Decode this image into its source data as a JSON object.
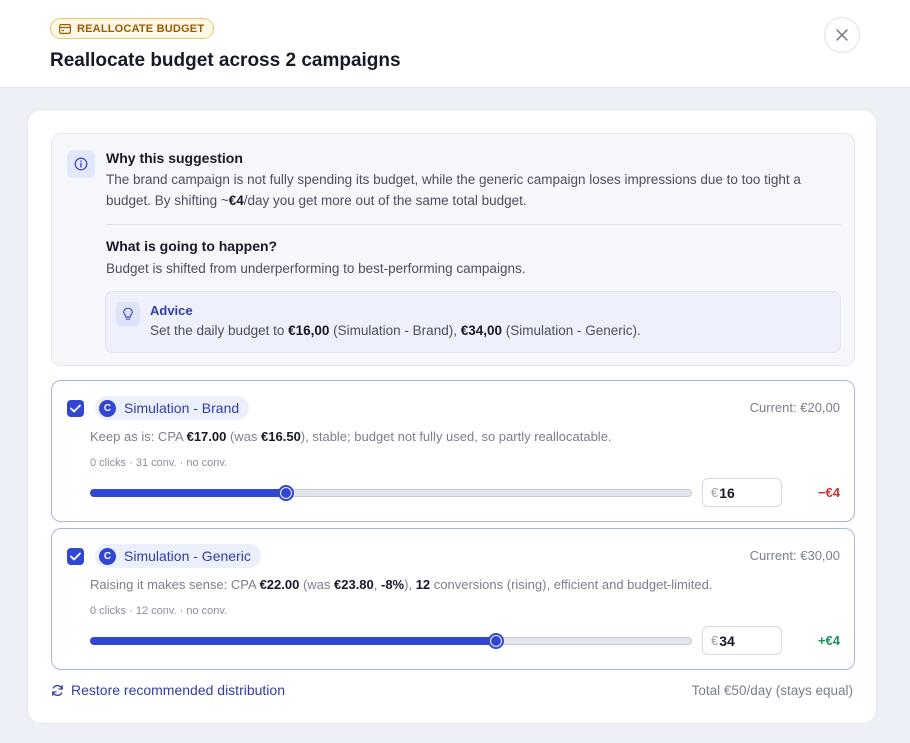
{
  "header": {
    "badge": "REALLOCATE BUDGET",
    "title": "Reallocate budget across 2 campaigns"
  },
  "info": {
    "why_title": "Why this suggestion",
    "why_text_1": "The brand campaign is not fully spending its budget, while the generic campaign loses impressions due to too tight a budget. By shifting ~",
    "why_amount": "€4",
    "why_text_2": "/day you get more out of the same total budget.",
    "what_title": "What is going to happen?",
    "what_text": "Budget is shifted from underperforming to best-performing campaigns.",
    "advice_title": "Advice",
    "advice_text_1": "Set the daily budget to ",
    "advice_amount_1": "€16,00",
    "advice_text_2": " (Simulation - Brand), ",
    "advice_amount_2": "€34,00",
    "advice_text_3": " (Simulation - Generic)."
  },
  "campaigns": [
    {
      "initial": "C",
      "name": "Simulation - Brand",
      "current": "Current: €20,00",
      "desc_1": "Keep as is: CPA ",
      "desc_b1": "€17.00",
      "desc_2": " (was ",
      "desc_b2": "€16.50",
      "desc_3": "), stable; budget not fully used, so partly reallocatable.",
      "stats": "0 clicks · 31 conv. · no conv.",
      "currency": "€",
      "value": "16",
      "slider_fraction": 0.325,
      "delta": "−€4",
      "delta_color": "#d12d2d",
      "checked": true
    },
    {
      "initial": "C",
      "name": "Simulation - Generic",
      "current": "Current: €30,00",
      "desc_1": "Raising it makes sense: CPA ",
      "desc_b1": "€22.00",
      "desc_2": " (was ",
      "desc_b2": "€23.80",
      "desc_3": ", ",
      "desc_b3": "-8%",
      "desc_4": "), ",
      "desc_b4": "12",
      "desc_5": " conversions (rising), efficient and budget-limited.",
      "stats": "0 clicks · 12 conv. · no conv.",
      "currency": "€",
      "value": "34",
      "slider_fraction": 0.675,
      "delta": "+€4",
      "delta_color": "#17915a",
      "checked": true
    }
  ],
  "footer": {
    "restore": "Restore recommended distribution",
    "total": "Total €50/day (stays equal)"
  },
  "colors": {
    "accent": "#3147d3",
    "negative": "#d12d2d",
    "positive": "#17915a",
    "badge": "#9a5b00"
  }
}
